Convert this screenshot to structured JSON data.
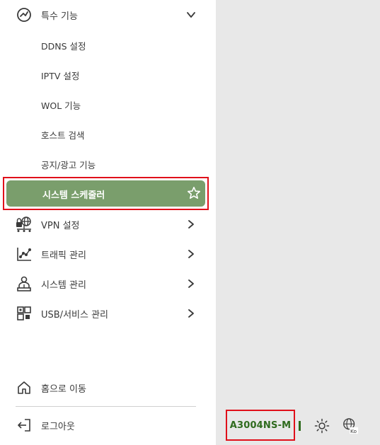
{
  "menu": {
    "special": {
      "label": "특수 기능",
      "icon": "special-functions-icon",
      "expanded": true
    },
    "sub_items": [
      {
        "label": "DDNS 설정"
      },
      {
        "label": "IPTV 설정"
      },
      {
        "label": "WOL 기능"
      },
      {
        "label": "호스트 검색"
      },
      {
        "label": "공지/광고 기능"
      }
    ],
    "active": {
      "label": "시스템 스케줄러",
      "icon": "star-icon"
    },
    "items": [
      {
        "label": "VPN 설정",
        "icon": "vpn-icon"
      },
      {
        "label": "트래픽 관리",
        "icon": "traffic-chart-icon"
      },
      {
        "label": "시스템 관리",
        "icon": "system-admin-icon"
      },
      {
        "label": "USB/서비스 관리",
        "icon": "usb-service-icon"
      }
    ],
    "bottom": {
      "home": {
        "label": "홈으로 이동",
        "icon": "home-icon"
      },
      "logout": {
        "label": "로그아웃",
        "icon": "logout-icon"
      }
    }
  },
  "footer": {
    "model": "A3004NS-M",
    "language_code": "Ko",
    "icons": [
      "brightness-icon",
      "language-globe-icon"
    ]
  },
  "colors": {
    "active_bg": "#7a9e6c",
    "highlight_border": "#e0101a",
    "model_text": "#2f6b1e",
    "right_pane_bg": "#e8e8e8"
  }
}
